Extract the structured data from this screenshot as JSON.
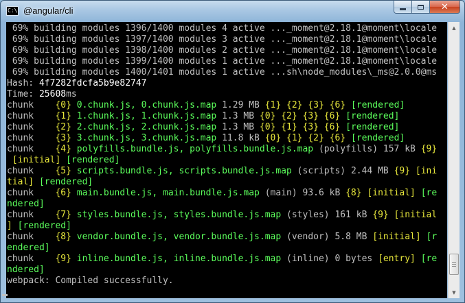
{
  "window": {
    "title": "@angular/cli",
    "icon": "cmd-console-icon",
    "icon_text": "C:\\"
  },
  "controls": {
    "minimize": "minimize-icon",
    "maximize": "maximize-icon",
    "close": "close-icon",
    "close_glyph": "✕"
  },
  "console": {
    "lines": [
      [
        {
          "t": " 69% building modules 1396/1400 modules 4 active ..._moment@2.18.1@moment\\locale",
          "c": "n"
        }
      ],
      [
        {
          "t": " 69% building modules 1397/1400 modules 3 active ..._moment@2.18.1@moment\\locale",
          "c": "n"
        }
      ],
      [
        {
          "t": " 69% building modules 1398/1400 modules 2 active ..._moment@2.18.1@moment\\locale",
          "c": "n"
        }
      ],
      [
        {
          "t": " 69% building modules 1399/1400 modules 1 active ..._moment@2.18.1@moment\\locale",
          "c": "n"
        }
      ],
      [
        {
          "t": " 69% building modules 1400/1401 modules 1 active ...sh\\node_modules\\_ms@2.0.0@ms",
          "c": "n"
        }
      ],
      [
        {
          "t": "Hash: ",
          "c": "n"
        },
        {
          "t": "4f7282fdcfa5b9e82747",
          "c": "b"
        }
      ],
      [
        {
          "t": "Time: ",
          "c": "n"
        },
        {
          "t": "25608",
          "c": "b"
        },
        {
          "t": "ms",
          "c": "n"
        }
      ],
      [
        {
          "t": "chunk    ",
          "c": "n"
        },
        {
          "t": "{0} ",
          "c": "y"
        },
        {
          "t": "0.chunk.js, 0.chunk.js.map ",
          "c": "g"
        },
        {
          "t": "1.29 MB ",
          "c": "n"
        },
        {
          "t": "{1} {2} {3} {6} ",
          "c": "y"
        },
        {
          "t": "[rendered]",
          "c": "g"
        }
      ],
      [
        {
          "t": "chunk    ",
          "c": "n"
        },
        {
          "t": "{1} ",
          "c": "y"
        },
        {
          "t": "1.chunk.js, 1.chunk.js.map ",
          "c": "g"
        },
        {
          "t": "1.3 MB ",
          "c": "n"
        },
        {
          "t": "{0} {2} {3} {6} ",
          "c": "y"
        },
        {
          "t": "[rendered]",
          "c": "g"
        }
      ],
      [
        {
          "t": "chunk    ",
          "c": "n"
        },
        {
          "t": "{2} ",
          "c": "y"
        },
        {
          "t": "2.chunk.js, 2.chunk.js.map ",
          "c": "g"
        },
        {
          "t": "1.3 MB ",
          "c": "n"
        },
        {
          "t": "{0} {1} {3} {6} ",
          "c": "y"
        },
        {
          "t": "[rendered]",
          "c": "g"
        }
      ],
      [
        {
          "t": "chunk    ",
          "c": "n"
        },
        {
          "t": "{3} ",
          "c": "y"
        },
        {
          "t": "3.chunk.js, 3.chunk.js.map ",
          "c": "g"
        },
        {
          "t": "11.8 kB ",
          "c": "n"
        },
        {
          "t": "{0} {1} {2} {6} ",
          "c": "y"
        },
        {
          "t": "[rendered]",
          "c": "g"
        }
      ],
      [
        {
          "t": "chunk    ",
          "c": "n"
        },
        {
          "t": "{4} ",
          "c": "y"
        },
        {
          "t": "polyfills.bundle.js, polyfills.bundle.js.map ",
          "c": "g"
        },
        {
          "t": "(polyfills) 157 kB ",
          "c": "n"
        },
        {
          "t": "{9}",
          "c": "y"
        }
      ],
      [
        {
          "t": " [initial] ",
          "c": "y"
        },
        {
          "t": "[rendered]",
          "c": "g"
        }
      ],
      [
        {
          "t": "chunk    ",
          "c": "n"
        },
        {
          "t": "{5} ",
          "c": "y"
        },
        {
          "t": "scripts.bundle.js, scripts.bundle.js.map ",
          "c": "g"
        },
        {
          "t": "(scripts) 2.44 MB ",
          "c": "n"
        },
        {
          "t": "{9} [ini",
          "c": "y"
        }
      ],
      [
        {
          "t": "tial] ",
          "c": "y"
        },
        {
          "t": "[rendered]",
          "c": "g"
        }
      ],
      [
        {
          "t": "chunk    ",
          "c": "n"
        },
        {
          "t": "{6} ",
          "c": "y"
        },
        {
          "t": "main.bundle.js, main.bundle.js.map ",
          "c": "g"
        },
        {
          "t": "(main) 93.6 kB ",
          "c": "n"
        },
        {
          "t": "{8} [initial] ",
          "c": "y"
        },
        {
          "t": "[re",
          "c": "g"
        }
      ],
      [
        {
          "t": "ndered]",
          "c": "g"
        }
      ],
      [
        {
          "t": "chunk    ",
          "c": "n"
        },
        {
          "t": "{7} ",
          "c": "y"
        },
        {
          "t": "styles.bundle.js, styles.bundle.js.map ",
          "c": "g"
        },
        {
          "t": "(styles) 161 kB ",
          "c": "n"
        },
        {
          "t": "{9} [initial",
          "c": "y"
        }
      ],
      [
        {
          "t": "] ",
          "c": "y"
        },
        {
          "t": "[rendered]",
          "c": "g"
        }
      ],
      [
        {
          "t": "chunk    ",
          "c": "n"
        },
        {
          "t": "{8} ",
          "c": "y"
        },
        {
          "t": "vendor.bundle.js, vendor.bundle.js.map ",
          "c": "g"
        },
        {
          "t": "(vendor) 5.8 MB ",
          "c": "n"
        },
        {
          "t": "[initial] ",
          "c": "y"
        },
        {
          "t": "[r",
          "c": "g"
        }
      ],
      [
        {
          "t": "endered]",
          "c": "g"
        }
      ],
      [
        {
          "t": "chunk    ",
          "c": "n"
        },
        {
          "t": "{9} ",
          "c": "y"
        },
        {
          "t": "inline.bundle.js, inline.bundle.js.map ",
          "c": "g"
        },
        {
          "t": "(inline) 0 bytes ",
          "c": "n"
        },
        {
          "t": "[entry] ",
          "c": "y"
        },
        {
          "t": "[re",
          "c": "g"
        }
      ],
      [
        {
          "t": "ndered]",
          "c": "g"
        }
      ],
      [
        {
          "t": "webpack: Compiled successfully.",
          "c": "n"
        }
      ]
    ]
  },
  "scrollbar": {
    "up_arrow": "▲",
    "down_arrow": "▼",
    "position": 0.95
  },
  "colors": {
    "background": "#000000",
    "text": "#c0c0c0",
    "bright": "#ffffff",
    "green": "#5cff5c",
    "yellow": "#e8e83c"
  }
}
